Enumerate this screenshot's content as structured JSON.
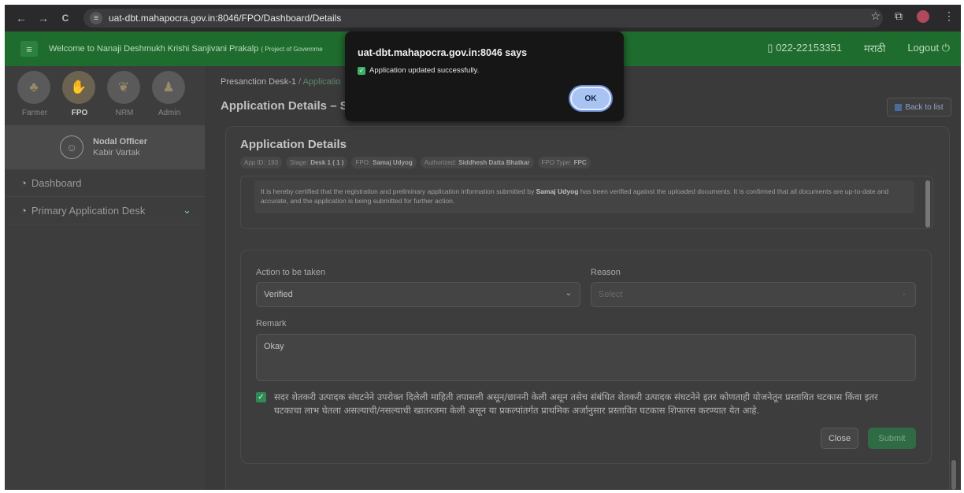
{
  "browser": {
    "url": "uat-dbt.mahapocra.gov.in:8046/FPO/Dashboard/Details",
    "back": "←",
    "forward": "→",
    "reload": "C"
  },
  "header": {
    "welcome": "Welcome to Nanaji Deshmukh Krishi Sanjivani Prakalp",
    "welcome_small": "( Project of Governme",
    "phone": "022-22153351",
    "language": "मराठी",
    "logout": "Logout"
  },
  "sidebar": {
    "roles": [
      {
        "label": "Farmer"
      },
      {
        "label": "FPO"
      },
      {
        "label": "NRM"
      },
      {
        "label": "Admin"
      }
    ],
    "user": {
      "role": "Nodal Officer",
      "name": "Kabir Vartak"
    },
    "menu": [
      {
        "label": "Dashboard"
      },
      {
        "label": "Primary Application Desk"
      }
    ]
  },
  "main": {
    "breadcrumb_1": "Presanction Desk-1",
    "breadcrumb_sep": " / ",
    "breadcrumb_2": "Applicatio",
    "page_title": "Application Details – Sar",
    "back_button": "Back to list"
  },
  "card": {
    "title": "Application Details",
    "chips": [
      {
        "label": "App ID:",
        "value": "193"
      },
      {
        "label": "Stage:",
        "value": "Desk 1 ( 1 )"
      },
      {
        "label": "FPO:",
        "value": "Samaj Udyog"
      },
      {
        "label": "Authorized:",
        "value": "Siddhesh Datta Bhatkar"
      },
      {
        "label": "FPO Type:",
        "value": "FPC"
      }
    ],
    "certification_pre": "It is hereby certified that the registration and preliminary application information submitted by ",
    "certification_bold": "Samaj Udyog",
    "certification_post": " has been verified against the uploaded documents. It is confirmed that all documents are up-to-date and accurate, and the application is being submitted for further action."
  },
  "form": {
    "action_label": "Action to be taken",
    "action_value": "Verified",
    "reason_label": "Reason",
    "reason_placeholder": "Select",
    "remark_label": "Remark",
    "remark_value": "Okay",
    "declaration": "सदर शेतकरी उत्पादक संघटनेने उपरोक्त दिलेली माहिती तपासली असून/छाननी केली असून तसेच संबंधित शेतकरी उत्पादक संघटनेने इतर कोणताही योजनेतून प्रस्तावित घटकास किंवा इतर घटकाचा लाभ घेतला असल्याची/नसल्याची खातरजमा केली असून या प्रकल्पांतर्गत प्राथमिक अर्जानुसार प्रस्तावित घटकास शिफारस करण्यात येत आहे.",
    "declaration_checked": true,
    "close_button": "Close",
    "submit_button": "Submit"
  },
  "dialog": {
    "title": "uat-dbt.mahapocra.gov.in:8046 says",
    "message": "Application updated successfully.",
    "ok_button": "OK"
  },
  "colors": {
    "header_green": "#1f6d2e",
    "submit_green": "#2f6b45",
    "ok_blue": "#a9c4f3"
  }
}
